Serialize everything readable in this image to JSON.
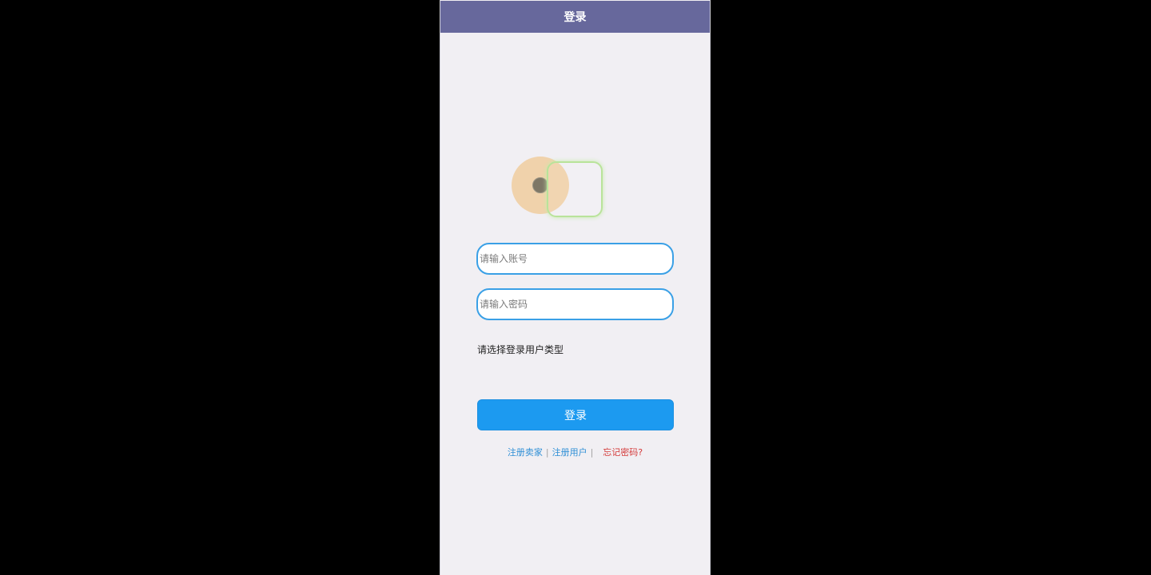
{
  "navbar": {
    "title": "登录"
  },
  "login_form": {
    "account_placeholder": "请输入账号",
    "password_placeholder": "请输入密码",
    "user_type_label": "请选择登录用户类型",
    "submit_label": "登录"
  },
  "footer_links": {
    "register_seller": "注册卖家",
    "register_user": "注册用户",
    "separator": "|",
    "forgot_password": "忘记密码?"
  },
  "colors": {
    "page_background": "#000000",
    "screen_background": "#f1eff3",
    "navbar": "#67689c",
    "input_border": "#3aa0e6",
    "login_button": "#1c9af0",
    "link": "#2f8fd6",
    "forgot_link": "#d43a3a"
  }
}
